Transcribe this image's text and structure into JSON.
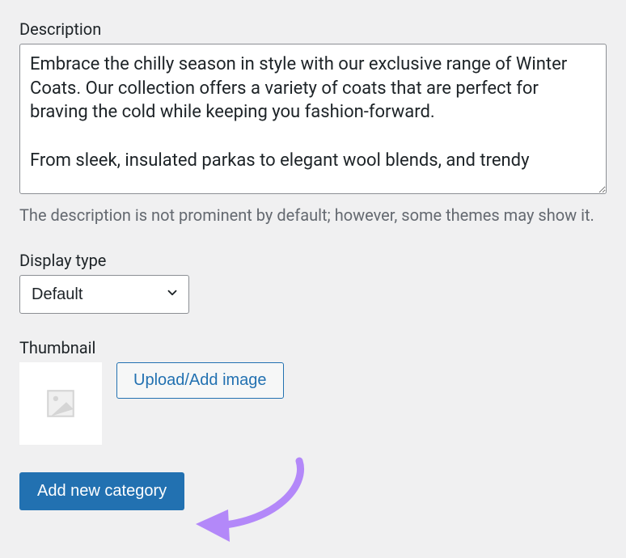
{
  "description": {
    "label": "Description",
    "value": "Embrace the chilly season in style with our exclusive range of Winter Coats. Our collection offers a variety of coats that are perfect for braving the cold while keeping you fashion-forward.\n\nFrom sleek, insulated parkas to elegant wool blends, and trendy",
    "helper": "The description is not prominent by default; however, some themes may show it."
  },
  "display_type": {
    "label": "Display type",
    "selected": "Default"
  },
  "thumbnail": {
    "label": "Thumbnail",
    "upload_label": "Upload/Add image"
  },
  "submit": {
    "label": "Add new category"
  },
  "colors": {
    "primary": "#2271b1",
    "annotation": "#b388f9"
  }
}
